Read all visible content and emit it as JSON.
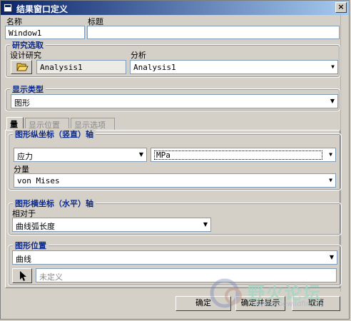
{
  "window": {
    "title": "结果窗口定义",
    "close_glyph": "×"
  },
  "name_field": {
    "label": "名称",
    "value": "Window1"
  },
  "title_field": {
    "label": "标题",
    "value": ""
  },
  "study_group": {
    "legend": "研究选取",
    "design_study_label": "设计研究",
    "design_study_value": "Analysis1",
    "analysis_label": "分析",
    "analysis_value": "Analysis1"
  },
  "display_type_group": {
    "legend": "显示类型",
    "value": "图形"
  },
  "tabs": [
    {
      "label": "量",
      "active": true
    },
    {
      "label": "显示位置",
      "active": false
    },
    {
      "label": "显示选项",
      "active": false
    }
  ],
  "y_axis_group": {
    "legend": "图形纵坐标（竖直）轴",
    "quantity_value": "应力",
    "unit_value": "MPa",
    "component_label": "分量",
    "component_value": "von Mises"
  },
  "x_axis_group": {
    "legend": "图形横坐标（水平）轴",
    "relative_label": "相对于",
    "relative_value": "曲线弧长度"
  },
  "location_group": {
    "legend": "图形位置",
    "type_value": "曲线",
    "selection_placeholder": "未定义"
  },
  "buttons": {
    "ok": "确定",
    "ok_show": "确定并显示",
    "cancel": "取消"
  },
  "watermark": {
    "text": "野火论坛",
    "url": "www.proewildfire.cn"
  },
  "icons": {
    "open": "folder-open-icon",
    "select": "arrow-cursor-icon",
    "dropdown": "chevron-down-icon"
  },
  "colors": {
    "title_start": "#0a246a",
    "title_end": "#a6caf0",
    "legend": "#0c2a8a"
  }
}
